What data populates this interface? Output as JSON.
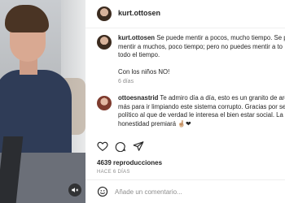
{
  "post": {
    "username": "kurt.ottosen",
    "caption_lines": [
      "Se puede mentir a pocos, mucho tiempo. Se p",
      "mentir a muchos, poco tiempo; pero no puedes mentir a to",
      "todo el tiempo."
    ],
    "caption_extra": "Con los niños NO!",
    "caption_time": "6 días"
  },
  "comment": {
    "username": "ottoesnastrid",
    "lines": [
      "Te admiro día a día, esto es un granito de aren",
      "más para ir limpiando este sistema corrupto. Gracias por ser",
      "político al que de verdad le interesa el bien estar social. La",
      "honestidad premiará 🤞🏼❤"
    ]
  },
  "stats": {
    "views": "4639 reproducciones",
    "ago": "HACE 6 DÍAS"
  },
  "input": {
    "placeholder": "Añade un comentario..."
  }
}
